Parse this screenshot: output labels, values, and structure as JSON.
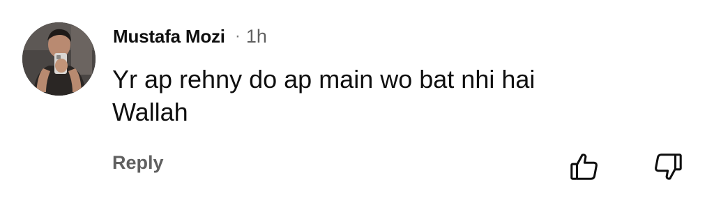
{
  "comment": {
    "author": "Mustafa Mozi",
    "separator": "·",
    "time": "1h",
    "text_lines": [
      "Yr ap rehny do ap main wo bat nhi hai",
      "Wallah"
    ],
    "reply_label": "Reply"
  },
  "icons": {
    "avatar": "user-avatar",
    "like": "thumbs-up-icon",
    "dislike": "thumbs-down-icon"
  },
  "colors": {
    "text_primary": "#0f0f0f",
    "text_secondary": "#606060"
  }
}
